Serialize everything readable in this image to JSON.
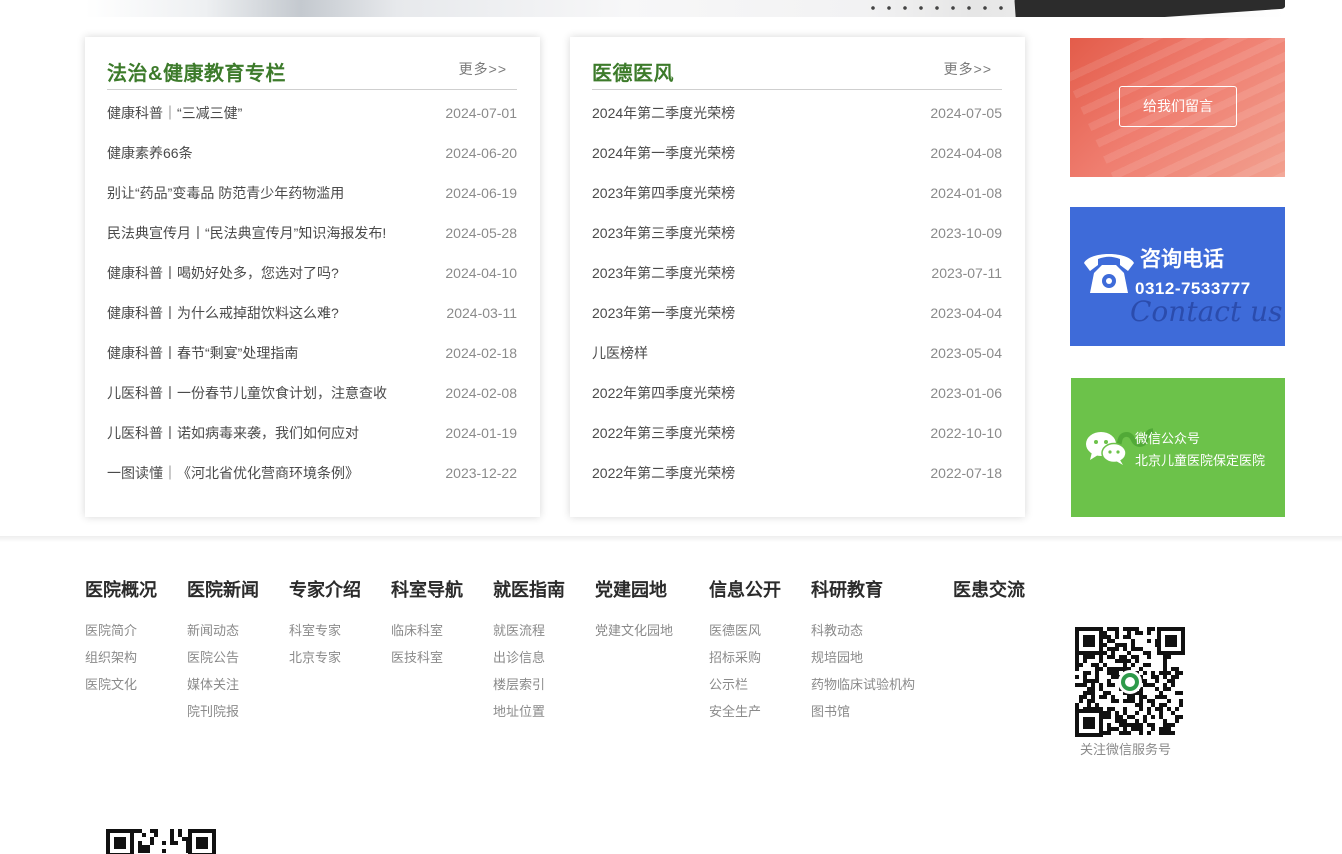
{
  "news_card": {
    "title": "法治&健康教育专栏",
    "more": "更多>>",
    "items": [
      {
        "title": "健康科普｜“三减三健”",
        "date": "2024-07-01"
      },
      {
        "title": "健康素养66条",
        "date": "2024-06-20"
      },
      {
        "title": "别让“药品”变毒品 防范青少年药物滥用",
        "date": "2024-06-19"
      },
      {
        "title": "民法典宣传月丨“民法典宣传月”知识海报发布!",
        "date": "2024-05-28"
      },
      {
        "title": "健康科普丨喝奶好处多，您选对了吗?",
        "date": "2024-04-10"
      },
      {
        "title": "健康科普丨为什么戒掉甜饮料这么难?",
        "date": "2024-03-11"
      },
      {
        "title": "健康科普丨春节“剩宴”处理指南",
        "date": "2024-02-18"
      },
      {
        "title": "儿医科普丨一份春节儿童饮食计划，注意查收",
        "date": "2024-02-08"
      },
      {
        "title": "儿医科普丨诺如病毒来袭，我们如何应对",
        "date": "2024-01-19"
      },
      {
        "title": "一图读懂｜《河北省优化营商环境条例》",
        "date": "2023-12-22"
      }
    ]
  },
  "ethics_card": {
    "title": "医德医风",
    "more": "更多>>",
    "items": [
      {
        "title": "2024年第二季度光荣榜",
        "date": "2024-07-05"
      },
      {
        "title": "2024年第一季度光荣榜",
        "date": "2024-04-08"
      },
      {
        "title": "2023年第四季度光荣榜",
        "date": "2024-01-08"
      },
      {
        "title": "2023年第三季度光荣榜",
        "date": "2023-10-09"
      },
      {
        "title": "2023年第二季度光荣榜",
        "date": "2023-07-11"
      },
      {
        "title": "2023年第一季度光荣榜",
        "date": "2023-04-04"
      },
      {
        "title": "儿医榜样",
        "date": "2023-05-04"
      },
      {
        "title": "2022年第四季度光荣榜",
        "date": "2023-01-06"
      },
      {
        "title": "2022年第三季度光荣榜",
        "date": "2022-10-10"
      },
      {
        "title": "2022年第二季度光荣榜",
        "date": "2022-07-18"
      }
    ]
  },
  "tiles": {
    "message_button": "给我们留言",
    "phone_label": "咨询电话",
    "phone_number": "0312-7533777",
    "phone_script": "Contact us",
    "wechat_line1": "微信公众号",
    "wechat_line2": "北京儿童医院保定医院"
  },
  "footer": {
    "columns": [
      {
        "title": "医院概况",
        "links": [
          "医院简介",
          "组织架构",
          "医院文化"
        ]
      },
      {
        "title": "医院新闻",
        "links": [
          "新闻动态",
          "医院公告",
          "媒体关注",
          "院刊院报"
        ]
      },
      {
        "title": "专家介绍",
        "links": [
          "科室专家",
          "北京专家"
        ]
      },
      {
        "title": "科室导航",
        "links": [
          "临床科室",
          "医技科室"
        ]
      },
      {
        "title": "就医指南",
        "links": [
          "就医流程",
          "出诊信息",
          "楼层索引",
          "地址位置"
        ]
      },
      {
        "title": "党建园地",
        "links": [
          "党建文化园地"
        ]
      },
      {
        "title": "信息公开",
        "links": [
          "医德医风",
          "招标采购",
          "公示栏",
          "安全生产"
        ]
      },
      {
        "title": "科研教育",
        "links": [
          "科教动态",
          "规培园地",
          "药物临床试验机构",
          "图书馆"
        ]
      },
      {
        "title": "医患交流",
        "links": []
      }
    ],
    "qr_caption": "关注微信服务号"
  }
}
